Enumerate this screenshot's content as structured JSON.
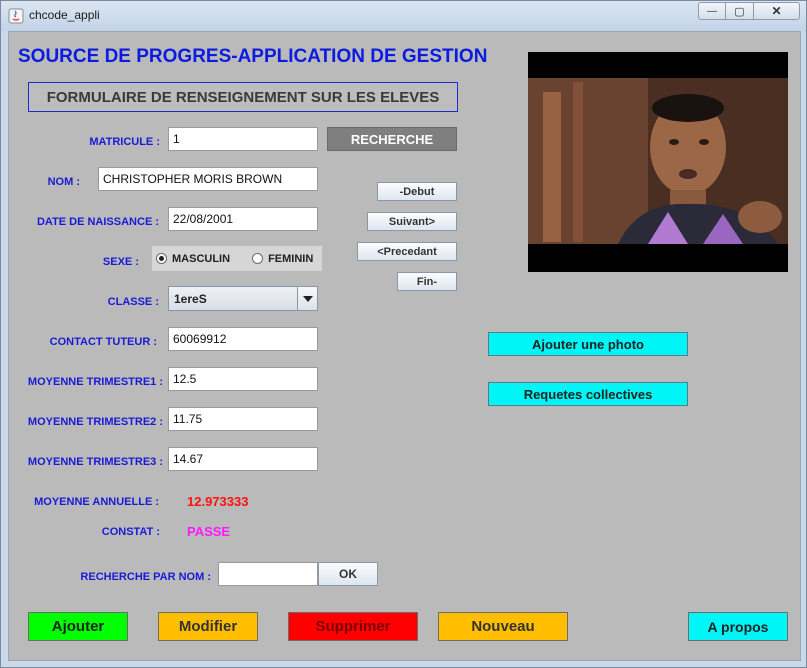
{
  "window": {
    "title": "chcode_appli",
    "min": "—",
    "max": "▢",
    "close": "✕"
  },
  "app_title": "SOURCE DE PROGRES-APPLICATION DE GESTION",
  "form_title": "FORMULAIRE DE RENSEIGNEMENT SUR LES ELEVES",
  "fields": {
    "matricule": {
      "label": "MATRICULE :",
      "value": "1"
    },
    "nom": {
      "label": "NOM :",
      "value": "CHRISTOPHER MORIS BROWN"
    },
    "date_naissance": {
      "label": "DATE DE NAISSANCE :",
      "value": "22/08/2001"
    },
    "sexe": {
      "label": "SEXE :",
      "options": [
        "MASCULIN",
        "FEMININ"
      ],
      "selected": "MASCULIN"
    },
    "classe": {
      "label": "CLASSE :",
      "value": "1ereS"
    },
    "contact": {
      "label": "CONTACT TUTEUR :",
      "value": "60069912"
    },
    "moy1": {
      "label": "MOYENNE TRIMESTRE1 :",
      "value": "12.5"
    },
    "moy2": {
      "label": "MOYENNE TRIMESTRE2 :",
      "value": "11.75"
    },
    "moy3": {
      "label": "MOYENNE TRIMESTRE3 :",
      "value": "14.67"
    }
  },
  "moyenne_annuelle": {
    "label": "MOYENNE ANNUELLE :",
    "value": "12.973333"
  },
  "constat": {
    "label": "CONSTAT :",
    "value": "PASSE"
  },
  "recherche_nom": {
    "label": "RECHERCHE PAR NOM :",
    "value": "",
    "ok": "OK"
  },
  "buttons": {
    "recherche": "RECHERCHE",
    "debut": "-Debut",
    "suivant": "Suivant>",
    "precedant": "<Precedant",
    "fin": "Fin-",
    "ajouter_photo": "Ajouter une photo",
    "requetes": "Requetes collectives",
    "ajouter": "Ajouter",
    "modifier": "Modifier",
    "supprimer": "Supprimer",
    "nouveau": "Nouveau",
    "apropos": "A propos"
  },
  "colors": {
    "label_blue": "#1a1ad6",
    "ajouter": "#00ff00",
    "modifier": "#ffbf00",
    "supprimer": "#ff0000",
    "nouveau": "#ffbf00",
    "cyan": "#00f6f6"
  }
}
